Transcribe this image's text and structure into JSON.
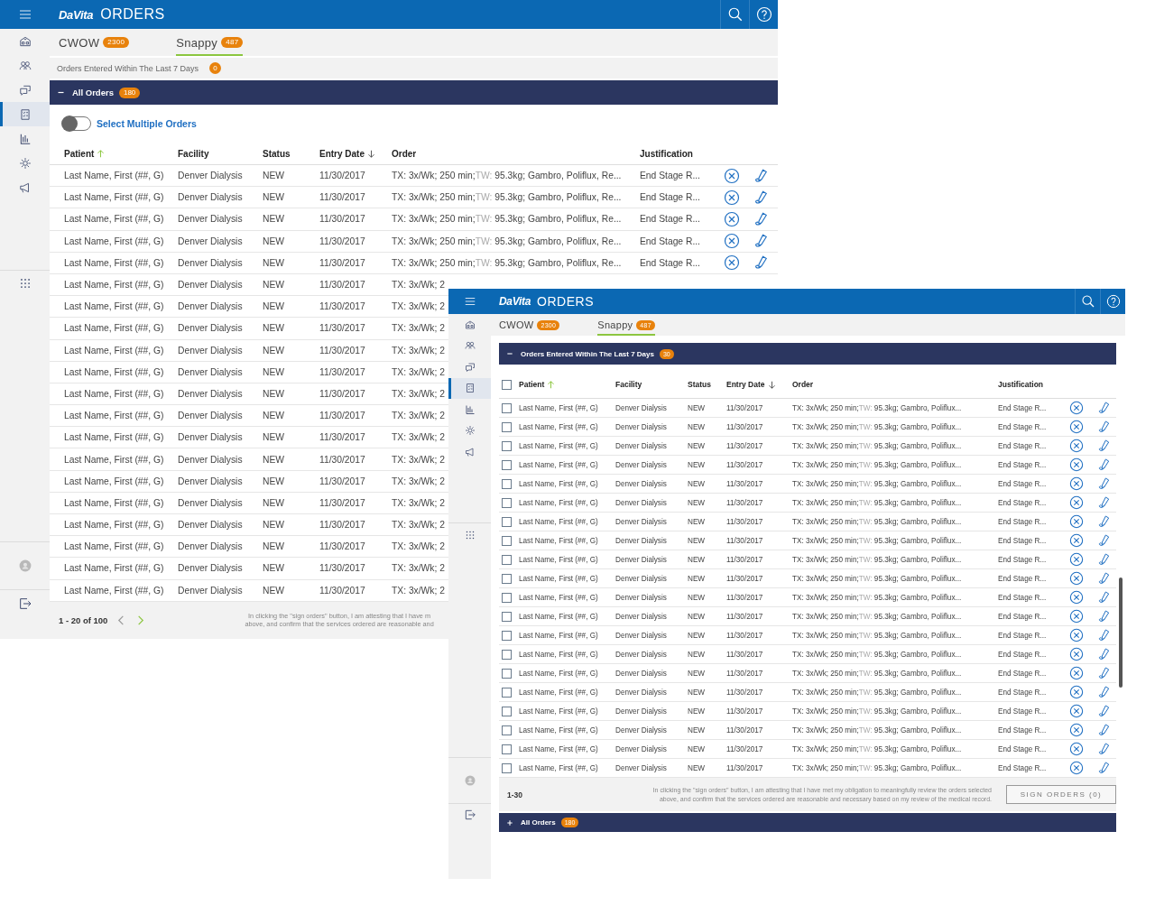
{
  "back": {
    "logo": "DaVita",
    "title": "ORDERS",
    "sidebar": {
      "items": [
        {
          "selected": false
        },
        {
          "selected": false
        },
        {
          "selected": false
        },
        {
          "selected": true
        },
        {
          "selected": false
        },
        {
          "selected": false
        },
        {
          "selected": false
        }
      ]
    },
    "tabs": [
      {
        "label": "CWOW",
        "count": "2300",
        "selected": false
      },
      {
        "label": "Snappy",
        "count": "487",
        "selected": true
      }
    ],
    "recent_section": {
      "label": "Orders Entered Within The Last 7 Days",
      "count": "0"
    },
    "all_section": {
      "label": "All Orders",
      "count": "180",
      "expanded": true
    },
    "toggle": {
      "label": "Select Multiple Orders",
      "on": false
    },
    "columns": [
      {
        "label": "Patient",
        "ascending": true
      },
      {
        "label": "Facility"
      },
      {
        "label": "Status"
      },
      {
        "label": "Entry Date",
        "ascending": false
      },
      {
        "label": "Order"
      },
      {
        "label": "Justification"
      }
    ],
    "rows": [
      {
        "patient": "Last Name, First (##, G)",
        "facility": "Denver Dialysis",
        "status": "NEW",
        "entry_date": "11/30/2017",
        "order": {
          "lead": "TX: 3x/Wk; 250 min;",
          "muted": "TW:",
          "tail": "95.3kg; Gambro, Poliflux, Re..."
        },
        "justification": "End Stage R..."
      },
      {
        "patient": "Last Name, First (##, G)",
        "facility": "Denver Dialysis",
        "status": "NEW",
        "entry_date": "11/30/2017",
        "order": {
          "lead": "TX: 3x/Wk; 250 min;",
          "muted": "TW:",
          "tail": "95.3kg; Gambro, Poliflux, Re..."
        },
        "justification": "End Stage R..."
      },
      {
        "patient": "Last Name, First (##, G)",
        "facility": "Denver Dialysis",
        "status": "NEW",
        "entry_date": "11/30/2017",
        "order": {
          "lead": "TX: 3x/Wk; 250 min;",
          "muted": "TW:",
          "tail": "95.3kg; Gambro, Poliflux, Re..."
        },
        "justification": "End Stage R..."
      },
      {
        "patient": "Last Name, First (##, G)",
        "facility": "Denver Dialysis",
        "status": "NEW",
        "entry_date": "11/30/2017",
        "order": {
          "lead": "TX: 3x/Wk; 250 min;",
          "muted": "TW:",
          "tail": "95.3kg; Gambro, Poliflux, Re..."
        },
        "justification": "End Stage R..."
      },
      {
        "patient": "Last Name, First (##, G)",
        "facility": "Denver Dialysis",
        "status": "NEW",
        "entry_date": "11/30/2017",
        "order": {
          "lead": "TX: 3x/Wk; 250 min;",
          "muted": "TW:",
          "tail": "95.3kg; Gambro, Poliflux, Re..."
        },
        "justification": "End Stage R..."
      },
      {
        "patient": "Last Name, First (##, G)",
        "facility": "Denver Dialysis",
        "status": "NEW",
        "entry_date": "11/30/2017",
        "order": {
          "lead": "TX: 3x/Wk; 2"
        }
      },
      {
        "patient": "Last Name, First (##, G)",
        "facility": "Denver Dialysis",
        "status": "NEW",
        "entry_date": "11/30/2017",
        "order": {
          "lead": "TX: 3x/Wk; 2"
        }
      },
      {
        "patient": "Last Name, First (##, G)",
        "facility": "Denver Dialysis",
        "status": "NEW",
        "entry_date": "11/30/2017",
        "order": {
          "lead": "TX: 3x/Wk; 2"
        }
      },
      {
        "patient": "Last Name, First (##, G)",
        "facility": "Denver Dialysis",
        "status": "NEW",
        "entry_date": "11/30/2017",
        "order": {
          "lead": "TX: 3x/Wk; 2"
        }
      },
      {
        "patient": "Last Name, First (##, G)",
        "facility": "Denver Dialysis",
        "status": "NEW",
        "entry_date": "11/30/2017",
        "order": {
          "lead": "TX: 3x/Wk; 2"
        }
      },
      {
        "patient": "Last Name, First (##, G)",
        "facility": "Denver Dialysis",
        "status": "NEW",
        "entry_date": "11/30/2017",
        "order": {
          "lead": "TX: 3x/Wk; 2"
        }
      },
      {
        "patient": "Last Name, First (##, G)",
        "facility": "Denver Dialysis",
        "status": "NEW",
        "entry_date": "11/30/2017",
        "order": {
          "lead": "TX: 3x/Wk; 2"
        }
      },
      {
        "patient": "Last Name, First (##, G)",
        "facility": "Denver Dialysis",
        "status": "NEW",
        "entry_date": "11/30/2017",
        "order": {
          "lead": "TX: 3x/Wk; 2"
        }
      },
      {
        "patient": "Last Name, First (##, G)",
        "facility": "Denver Dialysis",
        "status": "NEW",
        "entry_date": "11/30/2017",
        "order": {
          "lead": "TX: 3x/Wk; 2"
        }
      },
      {
        "patient": "Last Name, First (##, G)",
        "facility": "Denver Dialysis",
        "status": "NEW",
        "entry_date": "11/30/2017",
        "order": {
          "lead": "TX: 3x/Wk; 2"
        }
      },
      {
        "patient": "Last Name, First (##, G)",
        "facility": "Denver Dialysis",
        "status": "NEW",
        "entry_date": "11/30/2017",
        "order": {
          "lead": "TX: 3x/Wk; 2"
        }
      },
      {
        "patient": "Last Name, First (##, G)",
        "facility": "Denver Dialysis",
        "status": "NEW",
        "entry_date": "11/30/2017",
        "order": {
          "lead": "TX: 3x/Wk; 2"
        }
      },
      {
        "patient": "Last Name, First (##, G)",
        "facility": "Denver Dialysis",
        "status": "NEW",
        "entry_date": "11/30/2017",
        "order": {
          "lead": "TX: 3x/Wk; 2"
        }
      },
      {
        "patient": "Last Name, First (##, G)",
        "facility": "Denver Dialysis",
        "status": "NEW",
        "entry_date": "11/30/2017",
        "order": {
          "lead": "TX: 3x/Wk; 2"
        }
      },
      {
        "patient": "Last Name, First (##, G)",
        "facility": "Denver Dialysis",
        "status": "NEW",
        "entry_date": "11/30/2017",
        "order": {
          "lead": "TX: 3x/Wk; 2"
        }
      }
    ],
    "pagination": {
      "range": "1 - 20 of 100",
      "prev_enabled": false,
      "next_enabled": true
    },
    "attestation": "In clicking the \"sign orders\" button, I am attesting that I have m\nabove, and confirm that the services ordered are reasonable and"
  },
  "front": {
    "logo": "DaVita",
    "title": "ORDERS",
    "sidebar": {
      "items": [
        {
          "selected": false
        },
        {
          "selected": false
        },
        {
          "selected": false
        },
        {
          "selected": true
        },
        {
          "selected": false
        },
        {
          "selected": false
        },
        {
          "selected": false
        }
      ]
    },
    "tabs": [
      {
        "label": "CWOW",
        "count": "2300",
        "selected": false
      },
      {
        "label": "Snappy",
        "count": "487",
        "selected": true
      }
    ],
    "recent_section": {
      "label": "Orders Entered Within The Last 7 Days",
      "count": "30",
      "expanded": true
    },
    "select_all_checked": false,
    "columns": [
      {
        "label": "Patient",
        "ascending": true
      },
      {
        "label": "Facility"
      },
      {
        "label": "Status"
      },
      {
        "label": "Entry Date",
        "ascending": false
      },
      {
        "label": "Order"
      },
      {
        "label": "Justification"
      }
    ],
    "rows": [
      {
        "checked": false,
        "patient": "Last Name, First (##, G)",
        "facility": "Denver Dialysis",
        "status": "NEW",
        "entry_date": "11/30/2017",
        "order": {
          "lead": "TX: 3x/Wk; 250 min;",
          "muted": "TW:",
          "tail": "95.3kg; Gambro, Poliflux..."
        },
        "justification": "End Stage R..."
      },
      {
        "checked": false,
        "patient": "Last Name, First (##, G)",
        "facility": "Denver Dialysis",
        "status": "NEW",
        "entry_date": "11/30/2017",
        "order": {
          "lead": "TX: 3x/Wk; 250 min;",
          "muted": "TW:",
          "tail": "95.3kg; Gambro, Poliflux..."
        },
        "justification": "End Stage R..."
      },
      {
        "checked": false,
        "patient": "Last Name, First (##, G)",
        "facility": "Denver Dialysis",
        "status": "NEW",
        "entry_date": "11/30/2017",
        "order": {
          "lead": "TX: 3x/Wk; 250 min;",
          "muted": "TW:",
          "tail": "95.3kg; Gambro, Poliflux..."
        },
        "justification": "End Stage R..."
      },
      {
        "checked": false,
        "patient": "Last Name, First (##, G)",
        "facility": "Denver Dialysis",
        "status": "NEW",
        "entry_date": "11/30/2017",
        "order": {
          "lead": "TX: 3x/Wk; 250 min;",
          "muted": "TW:",
          "tail": "95.3kg; Gambro, Poliflux..."
        },
        "justification": "End Stage R..."
      },
      {
        "checked": false,
        "patient": "Last Name, First (##, G)",
        "facility": "Denver Dialysis",
        "status": "NEW",
        "entry_date": "11/30/2017",
        "order": {
          "lead": "TX: 3x/Wk; 250 min;",
          "muted": "TW:",
          "tail": "95.3kg; Gambro, Poliflux..."
        },
        "justification": "End Stage R..."
      },
      {
        "checked": false,
        "patient": "Last Name, First (##, G)",
        "facility": "Denver Dialysis",
        "status": "NEW",
        "entry_date": "11/30/2017",
        "order": {
          "lead": "TX: 3x/Wk; 250 min;",
          "muted": "TW:",
          "tail": "95.3kg; Gambro, Poliflux..."
        },
        "justification": "End Stage R..."
      },
      {
        "checked": false,
        "patient": "Last Name, First (##, G)",
        "facility": "Denver Dialysis",
        "status": "NEW",
        "entry_date": "11/30/2017",
        "order": {
          "lead": "TX: 3x/Wk; 250 min;",
          "muted": "TW:",
          "tail": "95.3kg; Gambro, Poliflux..."
        },
        "justification": "End Stage R..."
      },
      {
        "checked": false,
        "patient": "Last Name, First (##, G)",
        "facility": "Denver Dialysis",
        "status": "NEW",
        "entry_date": "11/30/2017",
        "order": {
          "lead": "TX: 3x/Wk; 250 min;",
          "muted": "TW:",
          "tail": "95.3kg; Gambro, Poliflux..."
        },
        "justification": "End Stage R..."
      },
      {
        "checked": false,
        "patient": "Last Name, First (##, G)",
        "facility": "Denver Dialysis",
        "status": "NEW",
        "entry_date": "11/30/2017",
        "order": {
          "lead": "TX: 3x/Wk; 250 min;",
          "muted": "TW:",
          "tail": "95.3kg; Gambro, Poliflux..."
        },
        "justification": "End Stage R..."
      },
      {
        "checked": false,
        "patient": "Last Name, First (##, G)",
        "facility": "Denver Dialysis",
        "status": "NEW",
        "entry_date": "11/30/2017",
        "order": {
          "lead": "TX: 3x/Wk; 250 min;",
          "muted": "TW:",
          "tail": "95.3kg; Gambro, Poliflux..."
        },
        "justification": "End Stage R..."
      },
      {
        "checked": false,
        "patient": "Last Name, First (##, G)",
        "facility": "Denver Dialysis",
        "status": "NEW",
        "entry_date": "11/30/2017",
        "order": {
          "lead": "TX: 3x/Wk; 250 min;",
          "muted": "TW:",
          "tail": "95.3kg; Gambro, Poliflux..."
        },
        "justification": "End Stage R..."
      },
      {
        "checked": false,
        "patient": "Last Name, First (##, G)",
        "facility": "Denver Dialysis",
        "status": "NEW",
        "entry_date": "11/30/2017",
        "order": {
          "lead": "TX: 3x/Wk; 250 min;",
          "muted": "TW:",
          "tail": "95.3kg; Gambro, Poliflux..."
        },
        "justification": "End Stage R..."
      },
      {
        "checked": false,
        "patient": "Last Name, First (##, G)",
        "facility": "Denver Dialysis",
        "status": "NEW",
        "entry_date": "11/30/2017",
        "order": {
          "lead": "TX: 3x/Wk; 250 min;",
          "muted": "TW:",
          "tail": "95.3kg; Gambro, Poliflux..."
        },
        "justification": "End Stage R..."
      },
      {
        "checked": false,
        "patient": "Last Name, First (##, G)",
        "facility": "Denver Dialysis",
        "status": "NEW",
        "entry_date": "11/30/2017",
        "order": {
          "lead": "TX: 3x/Wk; 250 min;",
          "muted": "TW:",
          "tail": "95.3kg; Gambro, Poliflux..."
        },
        "justification": "End Stage R..."
      },
      {
        "checked": false,
        "patient": "Last Name, First (##, G)",
        "facility": "Denver Dialysis",
        "status": "NEW",
        "entry_date": "11/30/2017",
        "order": {
          "lead": "TX: 3x/Wk; 250 min;",
          "muted": "TW:",
          "tail": "95.3kg; Gambro, Poliflux..."
        },
        "justification": "End Stage R..."
      },
      {
        "checked": false,
        "patient": "Last Name, First (##, G)",
        "facility": "Denver Dialysis",
        "status": "NEW",
        "entry_date": "11/30/2017",
        "order": {
          "lead": "TX: 3x/Wk; 250 min;",
          "muted": "TW:",
          "tail": "95.3kg; Gambro, Poliflux..."
        },
        "justification": "End Stage R..."
      },
      {
        "checked": false,
        "patient": "Last Name, First (##, G)",
        "facility": "Denver Dialysis",
        "status": "NEW",
        "entry_date": "11/30/2017",
        "order": {
          "lead": "TX: 3x/Wk; 250 min;",
          "muted": "TW:",
          "tail": "95.3kg; Gambro, Poliflux..."
        },
        "justification": "End Stage R..."
      },
      {
        "checked": false,
        "patient": "Last Name, First (##, G)",
        "facility": "Denver Dialysis",
        "status": "NEW",
        "entry_date": "11/30/2017",
        "order": {
          "lead": "TX: 3x/Wk; 250 min;",
          "muted": "TW:",
          "tail": "95.3kg; Gambro, Poliflux..."
        },
        "justification": "End Stage R..."
      },
      {
        "checked": false,
        "patient": "Last Name, First (##, G)",
        "facility": "Denver Dialysis",
        "status": "NEW",
        "entry_date": "11/30/2017",
        "order": {
          "lead": "TX: 3x/Wk; 250 min;",
          "muted": "TW:",
          "tail": "95.3kg; Gambro, Poliflux..."
        },
        "justification": "End Stage R..."
      },
      {
        "checked": false,
        "patient": "Last Name, First (##, G)",
        "facility": "Denver Dialysis",
        "status": "NEW",
        "entry_date": "11/30/2017",
        "order": {
          "lead": "TX: 3x/Wk; 250 min;",
          "muted": "TW:",
          "tail": "95.3kg; Gambro, Poliflux..."
        },
        "justification": "End Stage R..."
      }
    ],
    "range": "1-30",
    "attestation": "In clicking the \"sign orders\" button, I am attesting that I have met my obligation to meaningfully review the orders selected\nabove, and confirm that the services ordered are reasonable and necessary based on my review of the medical record.",
    "sign_button": {
      "label": "SIGN ORDERS (0)",
      "disabled": true
    },
    "all_section": {
      "label": "All Orders",
      "count": "180",
      "expanded": false
    }
  }
}
